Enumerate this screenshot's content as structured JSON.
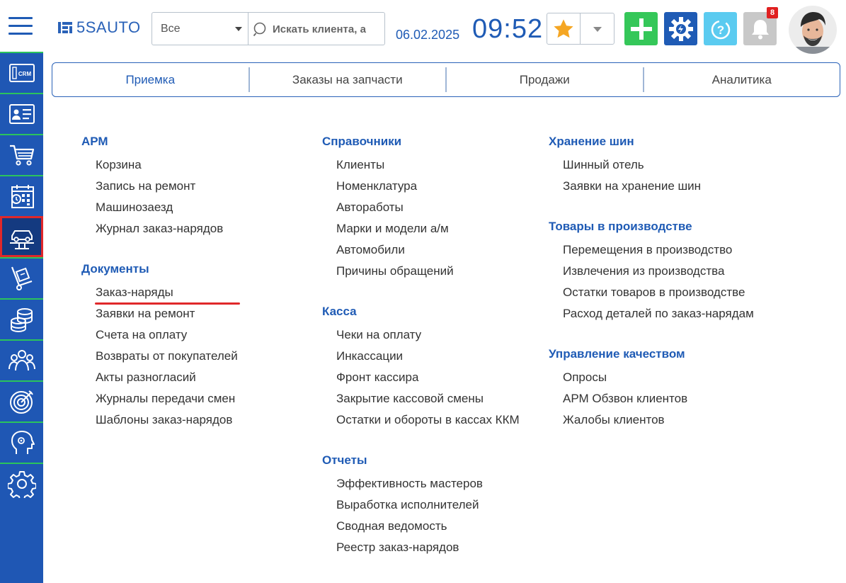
{
  "header": {
    "logo_text": "5SAUTO",
    "search": {
      "scope_value": "Все",
      "placeholder": "Искать клиента, а"
    },
    "date": "06.02.2025",
    "time": "09:52",
    "notifications_count": "8",
    "colors": {
      "brand": "#1f5bb5",
      "add": "#35c759",
      "help": "#5bcbf0",
      "bell": "#c8c8c8",
      "star": "#f5a623",
      "badge": "#e02020"
    },
    "icons": [
      "hamburger-icon",
      "search-icon",
      "star-icon",
      "chevron-down-icon",
      "plus-icon",
      "gear-icon",
      "help-icon",
      "bell-icon"
    ]
  },
  "sidebar": {
    "items": [
      {
        "id": "crm",
        "icon": "crm-icon",
        "label": "CRM"
      },
      {
        "id": "clients",
        "icon": "id-card-icon"
      },
      {
        "id": "cart",
        "icon": "cart-icon"
      },
      {
        "id": "calendar",
        "icon": "calendar-icon"
      },
      {
        "id": "car-lift",
        "icon": "car-lift-icon",
        "active": true
      },
      {
        "id": "hand-truck",
        "icon": "hand-truck-icon"
      },
      {
        "id": "coins",
        "icon": "coins-icon"
      },
      {
        "id": "team",
        "icon": "team-icon"
      },
      {
        "id": "target",
        "icon": "target-icon"
      },
      {
        "id": "head",
        "icon": "head-icon"
      },
      {
        "id": "settings",
        "icon": "settings-icon"
      }
    ]
  },
  "tabs": [
    {
      "label": "Приемка",
      "active": true
    },
    {
      "label": "Заказы на запчасти"
    },
    {
      "label": "Продажи"
    },
    {
      "label": "Аналитика"
    }
  ],
  "columns": [
    {
      "groups": [
        {
          "title": "АРМ",
          "items": [
            "Корзина",
            "Запись на ремонт",
            "Машинозаезд",
            "Журнал заказ-нарядов"
          ]
        },
        {
          "title": "Документы",
          "items": [
            "Заказ-наряды",
            "Заявки на ремонт",
            "Счета на оплату",
            "Возвраты от покупателей",
            "Акты разногласий",
            "Журналы передачи смен",
            "Шаблоны заказ-нарядов"
          ]
        }
      ]
    },
    {
      "groups": [
        {
          "title": "Справочники",
          "items": [
            "Клиенты",
            "Номенклатура",
            "Автоработы",
            "Марки и модели а/м",
            "Автомобили",
            "Причины обращений"
          ]
        },
        {
          "title": "Касса",
          "items": [
            "Чеки на оплату",
            "Инкассации",
            "Фронт кассира",
            "Закрытие кассовой смены",
            "Остатки и обороты в кассах ККМ"
          ]
        },
        {
          "title": "Отчеты",
          "items": [
            "Эффективность мастеров",
            "Выработка исполнителей",
            "Сводная ведомость",
            "Реестр заказ-нарядов"
          ]
        }
      ]
    },
    {
      "groups": [
        {
          "title": "Хранение шин",
          "items": [
            "Шинный отель",
            "Заявки на хранение шин"
          ]
        },
        {
          "title": "Товары в производстве",
          "items": [
            "Перемещения в производство",
            "Извлечения из производства",
            "Остатки товаров в производстве",
            "Расход деталей по заказ-нарядам"
          ]
        },
        {
          "title": "Управление качеством",
          "items": [
            "Опросы",
            "АРМ Обзвон клиентов",
            "Жалобы клиентов"
          ]
        }
      ]
    }
  ]
}
